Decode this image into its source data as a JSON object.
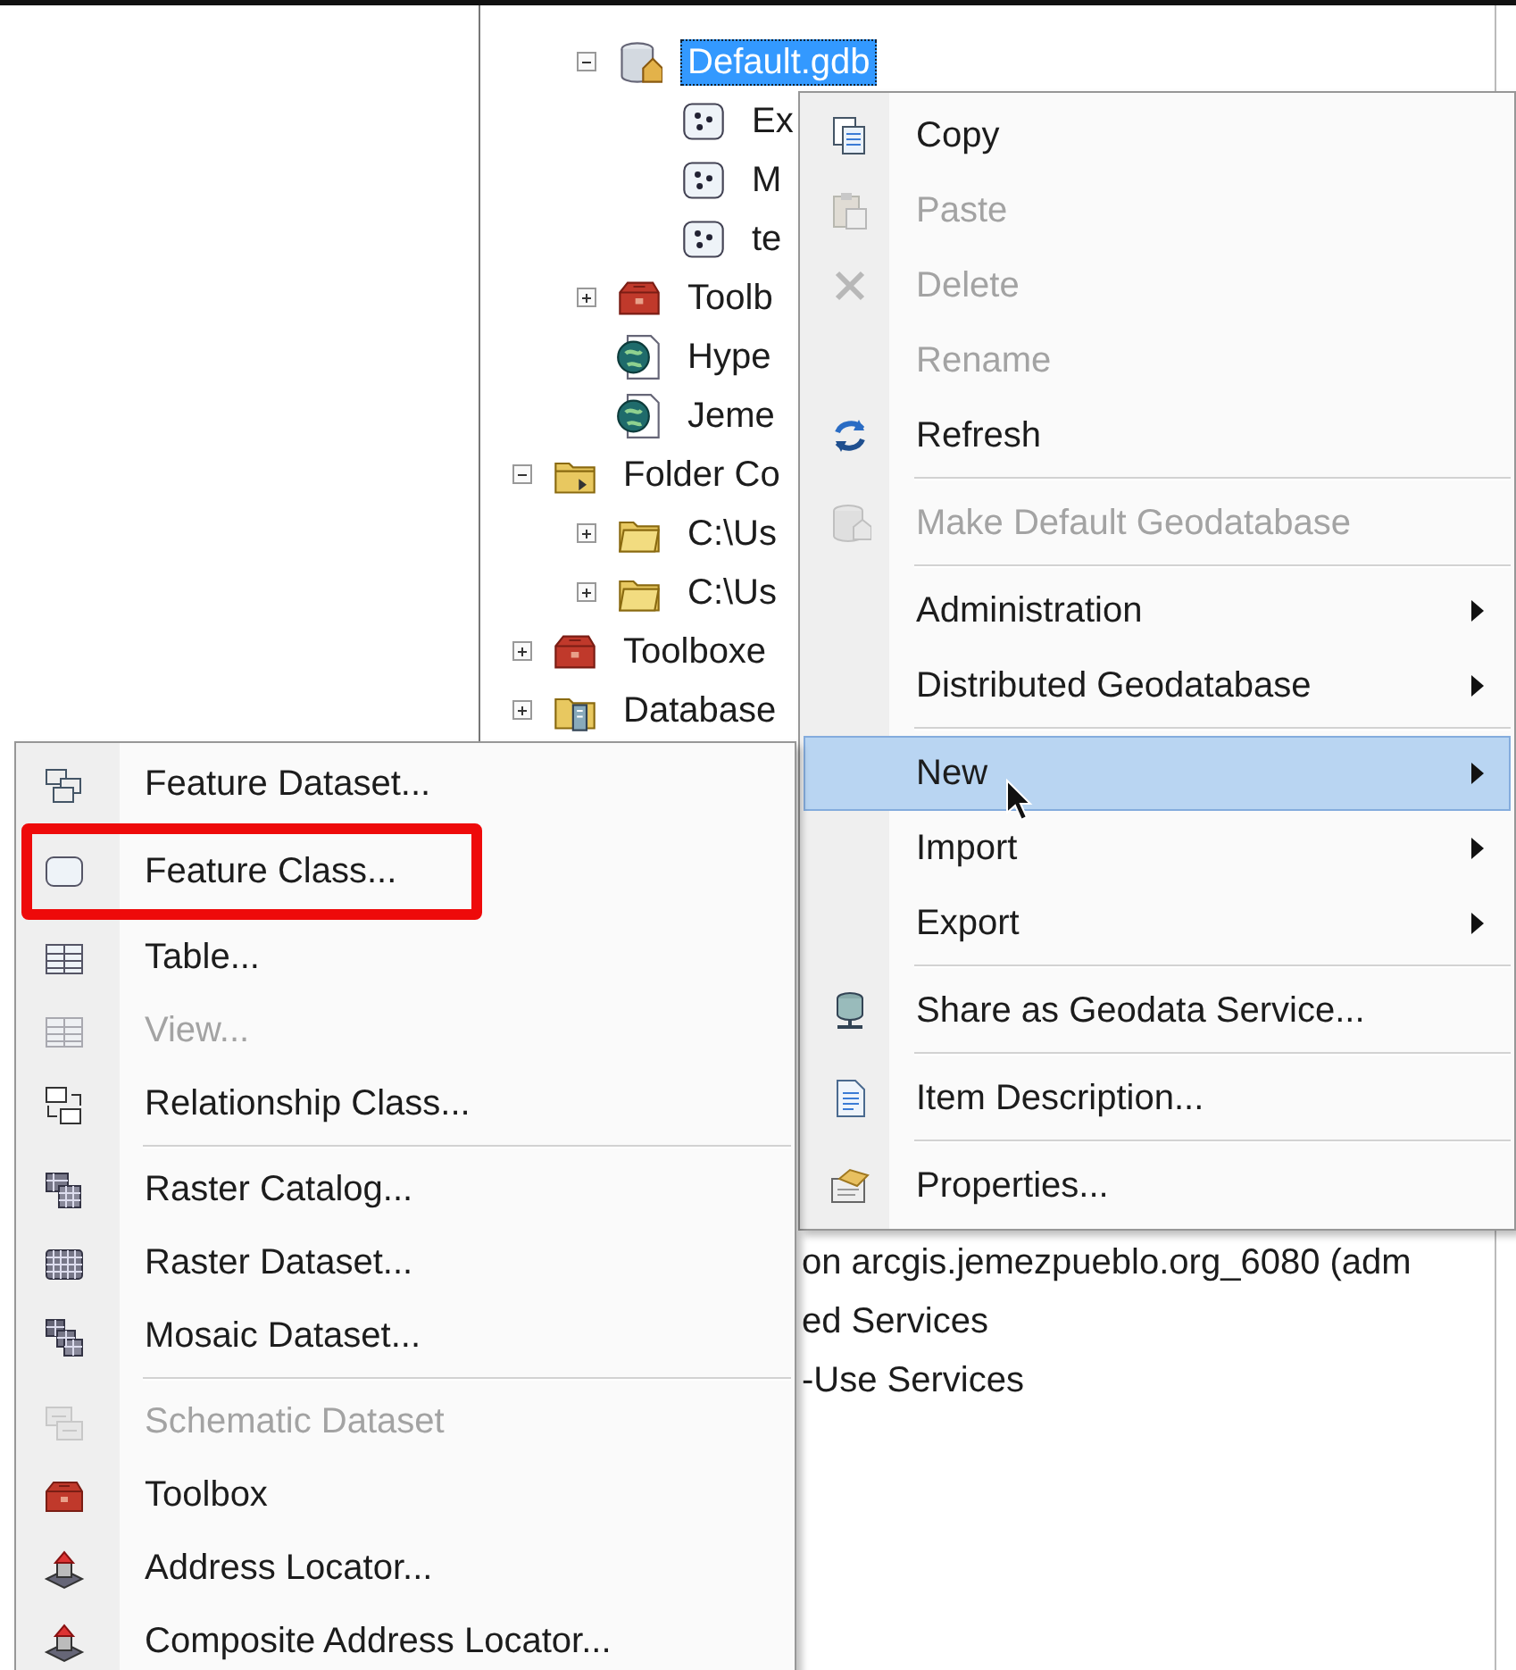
{
  "tree": {
    "continued_children": [
      {
        "label": "Default.gdb",
        "kind": "geodatabase",
        "expandable": true,
        "expanded": true,
        "selected": true,
        "children": [
          {
            "label": "Ex",
            "kind": "point-feature-class",
            "expandable": false,
            "selected": false
          },
          {
            "label": "M",
            "kind": "point-feature-class",
            "expandable": false,
            "selected": false
          },
          {
            "label": "te",
            "kind": "point-feature-class",
            "expandable": false,
            "selected": false
          }
        ]
      },
      {
        "label": "Toolb",
        "kind": "toolbox",
        "expandable": true,
        "expanded": false,
        "selected": false
      },
      {
        "label": "Hype",
        "kind": "locator-file",
        "expandable": false,
        "selected": false
      },
      {
        "label": "Jeme",
        "kind": "locator-file",
        "expandable": false,
        "selected": false
      }
    ],
    "items": [
      {
        "label": "Folder Co",
        "kind": "folder-connections",
        "expandable": true,
        "expanded": true,
        "selected": false,
        "children": [
          {
            "label": "C:\\Us",
            "kind": "folder",
            "expandable": true,
            "expanded": false,
            "selected": false
          },
          {
            "label": "C:\\Us",
            "kind": "folder",
            "expandable": true,
            "expanded": false,
            "selected": false
          }
        ]
      },
      {
        "label": "Toolboxe",
        "kind": "toolbox",
        "expandable": true,
        "expanded": false,
        "selected": false
      },
      {
        "label": "Database",
        "kind": "database-servers",
        "expandable": true,
        "expanded": false,
        "selected": false
      }
    ],
    "obscured_rows": [
      "on arcgis.jemezpueblo.org_6080 (adm",
      "ed Services",
      "-Use Services"
    ]
  },
  "context_menu": {
    "items": [
      {
        "kind": "copy",
        "label": "Copy",
        "disabled": false,
        "selected": false,
        "submenu": false
      },
      {
        "kind": "paste",
        "label": "Paste",
        "disabled": true,
        "selected": false,
        "submenu": false
      },
      {
        "kind": "delete",
        "label": "Delete",
        "disabled": true,
        "selected": false,
        "submenu": false
      },
      {
        "kind": "plain",
        "label": "Rename",
        "disabled": true,
        "selected": false,
        "submenu": false
      },
      {
        "kind": "refresh",
        "label": "Refresh",
        "disabled": false,
        "selected": false,
        "submenu": false
      },
      {
        "kind": "separator"
      },
      {
        "kind": "make-default",
        "label": "Make Default Geodatabase",
        "disabled": true,
        "selected": false,
        "submenu": false
      },
      {
        "kind": "separator"
      },
      {
        "kind": "plain",
        "label": "Administration",
        "disabled": false,
        "selected": false,
        "submenu": true
      },
      {
        "kind": "plain",
        "label": "Distributed Geodatabase",
        "disabled": false,
        "selected": false,
        "submenu": true
      },
      {
        "kind": "separator"
      },
      {
        "kind": "plain",
        "label": "New",
        "disabled": false,
        "selected": true,
        "submenu": true
      },
      {
        "kind": "plain",
        "label": "Import",
        "disabled": false,
        "selected": false,
        "submenu": true
      },
      {
        "kind": "plain",
        "label": "Export",
        "disabled": false,
        "selected": false,
        "submenu": true
      },
      {
        "kind": "separator"
      },
      {
        "kind": "share",
        "label": "Share as Geodata Service...",
        "disabled": false,
        "selected": false,
        "submenu": false
      },
      {
        "kind": "separator"
      },
      {
        "kind": "description",
        "label": "Item Description...",
        "disabled": false,
        "selected": false,
        "submenu": false
      },
      {
        "kind": "separator"
      },
      {
        "kind": "properties",
        "label": "Properties...",
        "disabled": false,
        "selected": false,
        "submenu": false
      }
    ]
  },
  "new_submenu": {
    "items": [
      {
        "kind": "feature-dataset",
        "label": "Feature Dataset...",
        "disabled": false,
        "highlighted": false
      },
      {
        "kind": "feature-class",
        "label": "Feature Class...",
        "disabled": false,
        "highlighted": true
      },
      {
        "kind": "table",
        "label": "Table...",
        "disabled": false,
        "highlighted": false
      },
      {
        "kind": "table",
        "label": "View...",
        "disabled": true,
        "highlighted": false
      },
      {
        "kind": "relationship",
        "label": "Relationship Class...",
        "disabled": false,
        "highlighted": false
      },
      {
        "kind": "separator"
      },
      {
        "kind": "raster-catalog",
        "label": "Raster Catalog...",
        "disabled": false,
        "highlighted": false
      },
      {
        "kind": "raster-dataset",
        "label": "Raster Dataset...",
        "disabled": false,
        "highlighted": false
      },
      {
        "kind": "mosaic",
        "label": "Mosaic Dataset...",
        "disabled": false,
        "highlighted": false
      },
      {
        "kind": "separator"
      },
      {
        "kind": "schematic",
        "label": "Schematic Dataset",
        "disabled": true,
        "highlighted": false
      },
      {
        "kind": "toolbox",
        "label": "Toolbox",
        "disabled": false,
        "highlighted": false
      },
      {
        "kind": "locator",
        "label": "Address Locator...",
        "disabled": false,
        "highlighted": false
      },
      {
        "kind": "locator",
        "label": "Composite Address Locator...",
        "disabled": false,
        "highlighted": false
      }
    ]
  },
  "mouse_cursor": {
    "visible": true
  }
}
